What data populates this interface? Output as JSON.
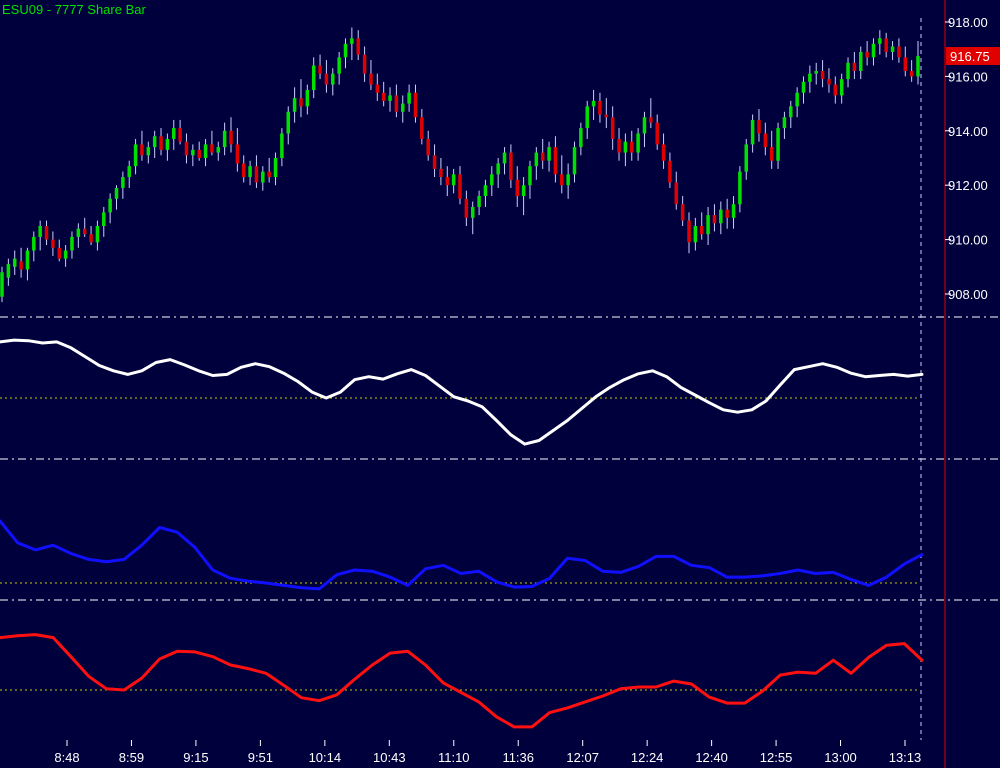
{
  "chart_data": {
    "type": "candlestick",
    "title": "ESU09 - 7777 Share Bar",
    "colors": {
      "background": "#00003c",
      "up": "#00e000",
      "down": "#e00000",
      "wick": "#c8d0ff",
      "axis": "#ffffff",
      "last_price_bg": "#e00000",
      "osc1": "#ffffff",
      "osc2": "#1010ff",
      "osc3": "#ff1010",
      "zero_line": "#c8c800",
      "separator": "#ffffff"
    },
    "price_axis": {
      "ticks": [
        "918.00",
        "916.00",
        "914.00",
        "912.00",
        "910.00",
        "908.00"
      ],
      "ylim": [
        907.2,
        918.6
      ],
      "last_price": 916.75,
      "last_price_label": "916.75"
    },
    "time_ticks": [
      "8:48",
      "8:59",
      "9:15",
      "9:51",
      "10:14",
      "10:43",
      "11:10",
      "11:36",
      "12:07",
      "12:24",
      "12:40",
      "12:55",
      "13:00",
      "13:13"
    ],
    "bars": [
      {
        "o": 907.9,
        "h": 909.0,
        "l": 907.7,
        "c": 908.8
      },
      {
        "o": 908.6,
        "h": 909.3,
        "l": 908.3,
        "c": 909.1
      },
      {
        "o": 909.0,
        "h": 909.6,
        "l": 908.7,
        "c": 909.3
      },
      {
        "o": 909.2,
        "h": 909.7,
        "l": 908.6,
        "c": 908.9
      },
      {
        "o": 908.9,
        "h": 909.7,
        "l": 908.5,
        "c": 909.6
      },
      {
        "o": 909.6,
        "h": 910.3,
        "l": 909.2,
        "c": 910.1
      },
      {
        "o": 910.1,
        "h": 910.7,
        "l": 909.6,
        "c": 910.5
      },
      {
        "o": 910.5,
        "h": 910.7,
        "l": 909.8,
        "c": 910.0
      },
      {
        "o": 910.0,
        "h": 910.3,
        "l": 909.4,
        "c": 909.7
      },
      {
        "o": 909.7,
        "h": 910.0,
        "l": 909.2,
        "c": 909.3
      },
      {
        "o": 909.3,
        "h": 909.8,
        "l": 909.0,
        "c": 909.6
      },
      {
        "o": 909.6,
        "h": 910.3,
        "l": 909.3,
        "c": 910.1
      },
      {
        "o": 910.1,
        "h": 910.6,
        "l": 909.7,
        "c": 910.4
      },
      {
        "o": 910.4,
        "h": 910.8,
        "l": 910.1,
        "c": 910.2
      },
      {
        "o": 910.2,
        "h": 910.5,
        "l": 909.8,
        "c": 909.9
      },
      {
        "o": 909.9,
        "h": 910.7,
        "l": 909.6,
        "c": 910.5
      },
      {
        "o": 910.5,
        "h": 911.2,
        "l": 910.1,
        "c": 911.0
      },
      {
        "o": 911.0,
        "h": 911.7,
        "l": 910.6,
        "c": 911.5
      },
      {
        "o": 911.5,
        "h": 912.0,
        "l": 911.1,
        "c": 911.9
      },
      {
        "o": 911.9,
        "h": 912.5,
        "l": 911.5,
        "c": 912.3
      },
      {
        "o": 912.3,
        "h": 912.9,
        "l": 911.9,
        "c": 912.7
      },
      {
        "o": 912.7,
        "h": 913.7,
        "l": 912.4,
        "c": 913.5
      },
      {
        "o": 913.5,
        "h": 914.0,
        "l": 912.9,
        "c": 913.1
      },
      {
        "o": 913.1,
        "h": 913.6,
        "l": 912.8,
        "c": 913.4
      },
      {
        "o": 913.4,
        "h": 914.0,
        "l": 913.0,
        "c": 913.8
      },
      {
        "o": 913.8,
        "h": 914.1,
        "l": 913.1,
        "c": 913.3
      },
      {
        "o": 913.3,
        "h": 913.9,
        "l": 912.9,
        "c": 913.7
      },
      {
        "o": 913.7,
        "h": 914.4,
        "l": 913.3,
        "c": 914.1
      },
      {
        "o": 914.1,
        "h": 914.4,
        "l": 913.5,
        "c": 913.6
      },
      {
        "o": 913.6,
        "h": 913.9,
        "l": 912.8,
        "c": 913.1
      },
      {
        "o": 913.1,
        "h": 913.5,
        "l": 912.7,
        "c": 913.3
      },
      {
        "o": 913.3,
        "h": 913.6,
        "l": 912.9,
        "c": 913.0
      },
      {
        "o": 913.0,
        "h": 913.7,
        "l": 912.7,
        "c": 913.5
      },
      {
        "o": 913.5,
        "h": 914.0,
        "l": 913.1,
        "c": 913.2
      },
      {
        "o": 913.2,
        "h": 913.6,
        "l": 912.9,
        "c": 913.4
      },
      {
        "o": 913.4,
        "h": 914.3,
        "l": 913.1,
        "c": 914.0
      },
      {
        "o": 914.0,
        "h": 914.5,
        "l": 913.2,
        "c": 913.5
      },
      {
        "o": 913.5,
        "h": 914.1,
        "l": 912.5,
        "c": 912.8
      },
      {
        "o": 912.8,
        "h": 913.1,
        "l": 912.1,
        "c": 912.3
      },
      {
        "o": 912.3,
        "h": 912.9,
        "l": 912.0,
        "c": 912.7
      },
      {
        "o": 912.7,
        "h": 913.1,
        "l": 911.9,
        "c": 912.1
      },
      {
        "o": 912.1,
        "h": 912.7,
        "l": 911.8,
        "c": 912.5
      },
      {
        "o": 912.5,
        "h": 913.0,
        "l": 912.1,
        "c": 912.3
      },
      {
        "o": 912.3,
        "h": 913.2,
        "l": 912.0,
        "c": 913.0
      },
      {
        "o": 913.0,
        "h": 914.1,
        "l": 912.7,
        "c": 913.9
      },
      {
        "o": 913.9,
        "h": 914.9,
        "l": 913.5,
        "c": 914.7
      },
      {
        "o": 914.7,
        "h": 915.6,
        "l": 914.3,
        "c": 915.2
      },
      {
        "o": 915.2,
        "h": 915.9,
        "l": 914.5,
        "c": 914.9
      },
      {
        "o": 914.9,
        "h": 915.7,
        "l": 914.6,
        "c": 915.5
      },
      {
        "o": 915.5,
        "h": 916.7,
        "l": 915.2,
        "c": 916.4
      },
      {
        "o": 916.4,
        "h": 916.8,
        "l": 915.9,
        "c": 916.1
      },
      {
        "o": 916.1,
        "h": 916.6,
        "l": 915.4,
        "c": 915.7
      },
      {
        "o": 915.7,
        "h": 916.3,
        "l": 915.3,
        "c": 916.1
      },
      {
        "o": 916.1,
        "h": 916.9,
        "l": 915.7,
        "c": 916.7
      },
      {
        "o": 916.7,
        "h": 917.4,
        "l": 916.3,
        "c": 917.2
      },
      {
        "o": 917.2,
        "h": 917.8,
        "l": 916.6,
        "c": 917.4
      },
      {
        "o": 917.4,
        "h": 917.7,
        "l": 916.6,
        "c": 916.8
      },
      {
        "o": 916.8,
        "h": 917.1,
        "l": 915.8,
        "c": 916.1
      },
      {
        "o": 916.1,
        "h": 916.6,
        "l": 915.5,
        "c": 915.7
      },
      {
        "o": 915.7,
        "h": 916.1,
        "l": 915.1,
        "c": 915.4
      },
      {
        "o": 915.4,
        "h": 915.8,
        "l": 914.9,
        "c": 915.1
      },
      {
        "o": 915.1,
        "h": 915.6,
        "l": 914.7,
        "c": 915.3
      },
      {
        "o": 915.3,
        "h": 915.7,
        "l": 914.5,
        "c": 914.7
      },
      {
        "o": 914.7,
        "h": 915.3,
        "l": 914.3,
        "c": 915.0
      },
      {
        "o": 915.0,
        "h": 915.7,
        "l": 914.7,
        "c": 915.4
      },
      {
        "o": 915.4,
        "h": 915.7,
        "l": 914.3,
        "c": 914.5
      },
      {
        "o": 914.5,
        "h": 914.8,
        "l": 913.5,
        "c": 913.7
      },
      {
        "o": 913.7,
        "h": 914.0,
        "l": 912.9,
        "c": 913.1
      },
      {
        "o": 913.1,
        "h": 913.5,
        "l": 912.3,
        "c": 912.6
      },
      {
        "o": 912.6,
        "h": 913.0,
        "l": 912.0,
        "c": 912.3
      },
      {
        "o": 912.3,
        "h": 912.7,
        "l": 911.6,
        "c": 912.0
      },
      {
        "o": 912.0,
        "h": 912.6,
        "l": 911.7,
        "c": 912.4
      },
      {
        "o": 912.4,
        "h": 912.7,
        "l": 911.3,
        "c": 911.5
      },
      {
        "o": 911.5,
        "h": 911.8,
        "l": 910.5,
        "c": 910.8
      },
      {
        "o": 910.8,
        "h": 911.4,
        "l": 910.2,
        "c": 911.2
      },
      {
        "o": 911.2,
        "h": 911.8,
        "l": 910.9,
        "c": 911.6
      },
      {
        "o": 911.6,
        "h": 912.2,
        "l": 911.2,
        "c": 912.0
      },
      {
        "o": 912.0,
        "h": 912.7,
        "l": 911.6,
        "c": 912.4
      },
      {
        "o": 912.4,
        "h": 913.0,
        "l": 911.9,
        "c": 912.8
      },
      {
        "o": 912.8,
        "h": 913.4,
        "l": 912.4,
        "c": 913.2
      },
      {
        "o": 913.2,
        "h": 913.5,
        "l": 911.9,
        "c": 912.2
      },
      {
        "o": 912.2,
        "h": 912.7,
        "l": 911.2,
        "c": 911.6
      },
      {
        "o": 911.6,
        "h": 912.3,
        "l": 910.9,
        "c": 912.0
      },
      {
        "o": 912.0,
        "h": 912.9,
        "l": 911.5,
        "c": 912.7
      },
      {
        "o": 912.7,
        "h": 913.4,
        "l": 912.2,
        "c": 913.2
      },
      {
        "o": 913.2,
        "h": 913.7,
        "l": 912.6,
        "c": 912.9
      },
      {
        "o": 912.9,
        "h": 913.6,
        "l": 912.5,
        "c": 913.4
      },
      {
        "o": 913.4,
        "h": 913.8,
        "l": 912.1,
        "c": 912.4
      },
      {
        "o": 912.4,
        "h": 913.1,
        "l": 911.7,
        "c": 912.0
      },
      {
        "o": 912.0,
        "h": 912.8,
        "l": 911.5,
        "c": 912.4
      },
      {
        "o": 912.4,
        "h": 913.6,
        "l": 912.1,
        "c": 913.4
      },
      {
        "o": 913.4,
        "h": 914.3,
        "l": 913.1,
        "c": 914.1
      },
      {
        "o": 914.1,
        "h": 915.1,
        "l": 913.7,
        "c": 914.9
      },
      {
        "o": 914.9,
        "h": 915.5,
        "l": 914.4,
        "c": 915.1
      },
      {
        "o": 915.1,
        "h": 915.4,
        "l": 914.3,
        "c": 914.6
      },
      {
        "o": 914.6,
        "h": 915.2,
        "l": 914.1,
        "c": 914.5
      },
      {
        "o": 914.5,
        "h": 914.9,
        "l": 913.3,
        "c": 913.7
      },
      {
        "o": 913.7,
        "h": 914.1,
        "l": 912.9,
        "c": 913.2
      },
      {
        "o": 913.2,
        "h": 913.9,
        "l": 912.7,
        "c": 913.6
      },
      {
        "o": 913.6,
        "h": 914.0,
        "l": 912.9,
        "c": 913.2
      },
      {
        "o": 913.2,
        "h": 914.1,
        "l": 912.9,
        "c": 913.9
      },
      {
        "o": 913.9,
        "h": 914.7,
        "l": 913.4,
        "c": 914.5
      },
      {
        "o": 914.5,
        "h": 915.2,
        "l": 914.1,
        "c": 914.3
      },
      {
        "o": 914.3,
        "h": 914.6,
        "l": 913.3,
        "c": 913.5
      },
      {
        "o": 913.5,
        "h": 913.9,
        "l": 912.6,
        "c": 912.9
      },
      {
        "o": 912.9,
        "h": 913.2,
        "l": 911.9,
        "c": 912.1
      },
      {
        "o": 912.1,
        "h": 912.5,
        "l": 911.1,
        "c": 911.3
      },
      {
        "o": 911.3,
        "h": 911.6,
        "l": 910.5,
        "c": 910.7
      },
      {
        "o": 910.7,
        "h": 911.0,
        "l": 909.5,
        "c": 909.9
      },
      {
        "o": 909.9,
        "h": 910.8,
        "l": 909.6,
        "c": 910.5
      },
      {
        "o": 910.5,
        "h": 911.0,
        "l": 910.0,
        "c": 910.2
      },
      {
        "o": 910.2,
        "h": 911.2,
        "l": 909.8,
        "c": 910.9
      },
      {
        "o": 910.9,
        "h": 911.3,
        "l": 910.3,
        "c": 910.6
      },
      {
        "o": 910.6,
        "h": 911.4,
        "l": 910.2,
        "c": 911.1
      },
      {
        "o": 911.1,
        "h": 911.5,
        "l": 910.4,
        "c": 910.8
      },
      {
        "o": 910.8,
        "h": 911.6,
        "l": 910.4,
        "c": 911.3
      },
      {
        "o": 911.3,
        "h": 912.7,
        "l": 911.0,
        "c": 912.5
      },
      {
        "o": 912.5,
        "h": 913.7,
        "l": 912.2,
        "c": 913.5
      },
      {
        "o": 913.5,
        "h": 914.6,
        "l": 913.2,
        "c": 914.4
      },
      {
        "o": 914.4,
        "h": 914.8,
        "l": 913.6,
        "c": 913.9
      },
      {
        "o": 913.9,
        "h": 914.3,
        "l": 913.1,
        "c": 913.4
      },
      {
        "o": 913.4,
        "h": 914.0,
        "l": 912.6,
        "c": 912.9
      },
      {
        "o": 912.9,
        "h": 914.3,
        "l": 912.6,
        "c": 914.1
      },
      {
        "o": 914.1,
        "h": 914.7,
        "l": 913.7,
        "c": 914.5
      },
      {
        "o": 914.5,
        "h": 915.1,
        "l": 914.1,
        "c": 914.9
      },
      {
        "o": 914.9,
        "h": 915.6,
        "l": 914.5,
        "c": 915.4
      },
      {
        "o": 915.4,
        "h": 916.0,
        "l": 915.0,
        "c": 915.8
      },
      {
        "o": 915.8,
        "h": 916.4,
        "l": 915.4,
        "c": 916.1
      },
      {
        "o": 916.1,
        "h": 916.5,
        "l": 915.7,
        "c": 916.2
      },
      {
        "o": 916.2,
        "h": 916.6,
        "l": 915.6,
        "c": 915.9
      },
      {
        "o": 915.9,
        "h": 916.3,
        "l": 915.4,
        "c": 915.7
      },
      {
        "o": 915.7,
        "h": 916.0,
        "l": 915.0,
        "c": 915.3
      },
      {
        "o": 915.3,
        "h": 916.1,
        "l": 915.0,
        "c": 915.9
      },
      {
        "o": 915.9,
        "h": 916.7,
        "l": 915.6,
        "c": 916.5
      },
      {
        "o": 916.5,
        "h": 916.9,
        "l": 915.9,
        "c": 916.2
      },
      {
        "o": 916.2,
        "h": 917.1,
        "l": 915.9,
        "c": 916.9
      },
      {
        "o": 916.9,
        "h": 917.3,
        "l": 916.4,
        "c": 916.7
      },
      {
        "o": 916.7,
        "h": 917.4,
        "l": 916.4,
        "c": 917.2
      },
      {
        "o": 917.2,
        "h": 917.7,
        "l": 916.8,
        "c": 917.4
      },
      {
        "o": 917.4,
        "h": 917.6,
        "l": 916.7,
        "c": 916.9
      },
      {
        "o": 916.9,
        "h": 917.3,
        "l": 916.6,
        "c": 917.1
      },
      {
        "o": 917.1,
        "h": 917.4,
        "l": 916.5,
        "c": 916.7
      },
      {
        "o": 916.7,
        "h": 917.1,
        "l": 916.0,
        "c": 916.2
      },
      {
        "o": 916.2,
        "h": 916.6,
        "l": 915.8,
        "c": 916.0
      },
      {
        "o": 916.0,
        "h": 917.3,
        "l": 915.7,
        "c": 916.75
      }
    ],
    "oscillators": [
      {
        "id": "osc1",
        "baseline": 0,
        "yrange": [
          -1,
          1
        ],
        "values": [
          0.95,
          0.98,
          0.97,
          0.93,
          0.95,
          0.85,
          0.7,
          0.55,
          0.46,
          0.4,
          0.46,
          0.6,
          0.65,
          0.56,
          0.46,
          0.38,
          0.4,
          0.52,
          0.58,
          0.53,
          0.42,
          0.28,
          0.1,
          0.0,
          0.1,
          0.31,
          0.36,
          0.32,
          0.41,
          0.48,
          0.38,
          0.2,
          0.02,
          -0.05,
          -0.15,
          -0.38,
          -0.62,
          -0.78,
          -0.72,
          -0.55,
          -0.38,
          -0.18,
          0.02,
          0.18,
          0.31,
          0.41,
          0.46,
          0.36,
          0.18,
          0.05,
          -0.08,
          -0.2,
          -0.24,
          -0.2,
          -0.05,
          0.22,
          0.48,
          0.53,
          0.58,
          0.52,
          0.42,
          0.36,
          0.38,
          0.4,
          0.37,
          0.4
        ]
      },
      {
        "id": "osc2",
        "baseline": 0,
        "yrange": [
          -1,
          1
        ],
        "values": [
          1.05,
          0.68,
          0.56,
          0.64,
          0.5,
          0.4,
          0.36,
          0.4,
          0.64,
          0.94,
          0.86,
          0.6,
          0.22,
          0.08,
          0.03,
          0.0,
          -0.04,
          -0.08,
          -0.1,
          0.14,
          0.22,
          0.2,
          0.1,
          -0.04,
          0.24,
          0.3,
          0.16,
          0.2,
          0.02,
          -0.07,
          -0.06,
          0.08,
          0.42,
          0.38,
          0.2,
          0.18,
          0.28,
          0.45,
          0.45,
          0.3,
          0.26,
          0.1,
          0.1,
          0.12,
          0.16,
          0.22,
          0.16,
          0.18,
          0.06,
          -0.04,
          0.1,
          0.32,
          0.48
        ]
      },
      {
        "id": "osc3",
        "baseline": 0,
        "yrange": [
          -1,
          1
        ],
        "values": [
          0.88,
          0.91,
          0.93,
          0.88,
          0.56,
          0.23,
          0.02,
          0.0,
          0.2,
          0.52,
          0.65,
          0.64,
          0.56,
          0.42,
          0.36,
          0.28,
          0.08,
          -0.13,
          -0.18,
          -0.08,
          0.18,
          0.42,
          0.62,
          0.65,
          0.42,
          0.12,
          -0.04,
          -0.2,
          -0.45,
          -0.62,
          -0.62,
          -0.38,
          -0.3,
          -0.2,
          -0.1,
          0.02,
          0.05,
          0.05,
          0.15,
          0.1,
          -0.12,
          -0.22,
          -0.22,
          -0.02,
          0.25,
          0.3,
          0.28,
          0.5,
          0.28,
          0.55,
          0.75,
          0.78,
          0.5
        ]
      }
    ]
  }
}
